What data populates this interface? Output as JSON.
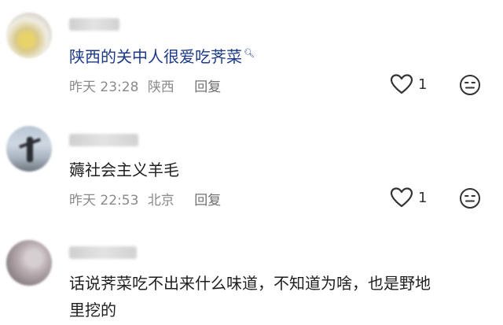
{
  "comments": [
    {
      "text": "陕西的关中人很爱吃荠菜",
      "has_search_icon": true,
      "time": "昨天 23:28",
      "location": "陕西",
      "reply_label": "回复",
      "likes": "1"
    },
    {
      "text": "薅社会主义羊毛",
      "has_search_icon": false,
      "time": "昨天 22:53",
      "location": "北京",
      "reply_label": "回复",
      "likes": "1"
    },
    {
      "text_line1": "话说荠菜吃不出来什么味道，不知道为啥，也是野地",
      "text_line2": "里挖的"
    }
  ],
  "icons": {
    "like": "heart-outline-icon",
    "emoji": "smiley-face-icon",
    "search": "search-icon"
  }
}
